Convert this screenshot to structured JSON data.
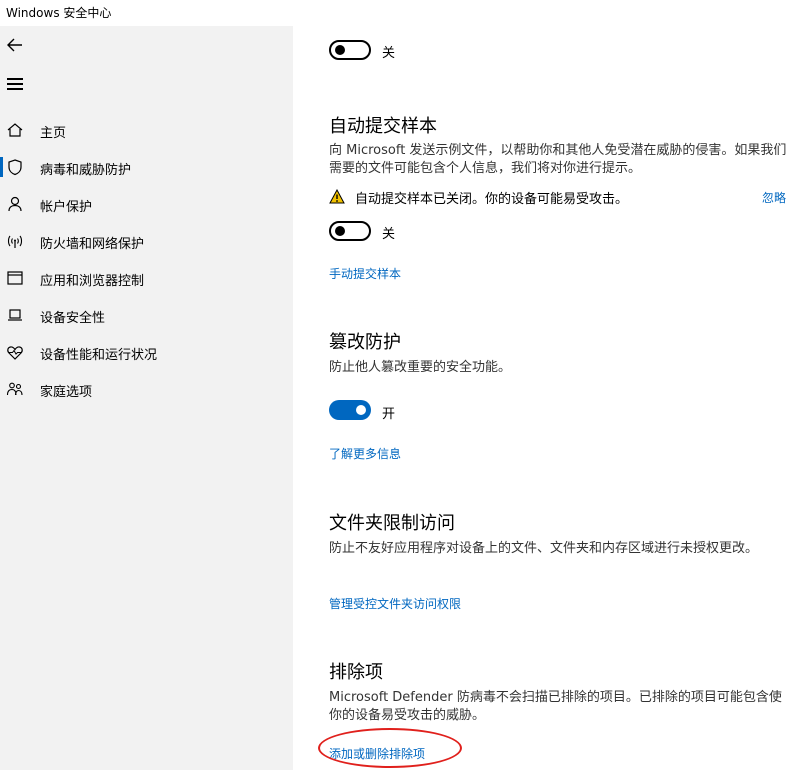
{
  "window": {
    "title": "Windows 安全中心"
  },
  "sidebar": {
    "back_icon": "back-arrow-icon",
    "menu_icon": "hamburger-icon",
    "active_color": "#0067c0",
    "items": [
      {
        "label": "主页",
        "icon": "home-icon"
      },
      {
        "label": "病毒和威胁防护",
        "icon": "shield-icon",
        "active": true
      },
      {
        "label": "帐户保护",
        "icon": "person-icon"
      },
      {
        "label": "防火墙和网络保护",
        "icon": "wifi-signal-icon"
      },
      {
        "label": "应用和浏览器控制",
        "icon": "app-window-icon"
      },
      {
        "label": "设备安全性",
        "icon": "laptop-icon"
      },
      {
        "label": "设备性能和运行状况",
        "icon": "heart-pulse-icon"
      },
      {
        "label": "家庭选项",
        "icon": "family-icon"
      }
    ]
  },
  "main": {
    "top_toggle": {
      "state": "off",
      "label": "关"
    },
    "auto_submit": {
      "title": "自动提交样本",
      "description": "向 Microsoft 发送示例文件，以帮助你和其他人免受潜在威胁的侵害。如果我们需要的文件可能包含个人信息，我们将对你进行提示。",
      "warning": "自动提交样本已关闭。你的设备可能易受攻击。",
      "dismiss": "忽略",
      "toggle": {
        "state": "off",
        "label": "关"
      },
      "link": "手动提交样本"
    },
    "tamper": {
      "title": "篡改防护",
      "description": "防止他人篡改重要的安全功能。",
      "toggle": {
        "state": "on",
        "label": "开"
      },
      "link": "了解更多信息"
    },
    "folder_access": {
      "title": "文件夹限制访问",
      "description": "防止不友好应用程序对设备上的文件、文件夹和内存区域进行未授权更改。",
      "link": "管理受控文件夹访问权限"
    },
    "exclusions": {
      "title": "排除项",
      "description": "Microsoft Defender 防病毒不会扫描已排除的项目。已排除的项目可能包含使你的设备易受攻击的威胁。",
      "link": "添加或删除排除项"
    }
  },
  "colors": {
    "accent": "#0067c0",
    "annotation": "#e0201c",
    "warning": "#f2c200"
  }
}
